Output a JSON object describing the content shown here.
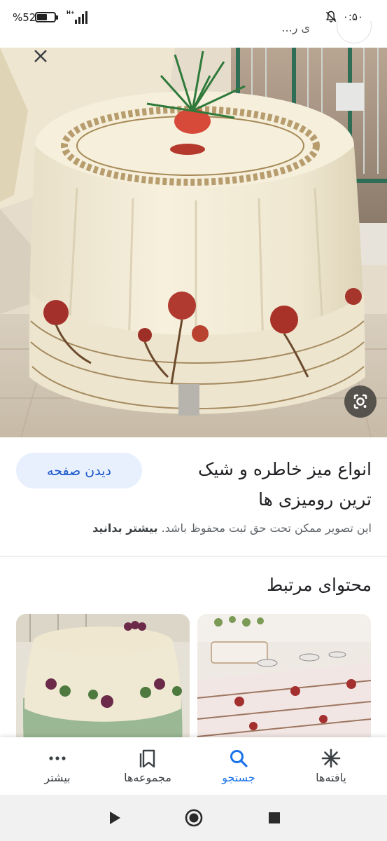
{
  "status_bar": {
    "battery_percent": "52",
    "battery_level": 0.52,
    "network": "H+",
    "time": "۰:۵۰"
  },
  "underlay": {
    "title_fragment": "...ی ر"
  },
  "viewer": {
    "close_icon": "close-icon",
    "lens_icon": "google-lens-icon"
  },
  "result": {
    "visit_label": "دیدن صفحه",
    "title": "انواع میز خاطره و شیک ترین رومیزی ها",
    "copyright_text": "این تصویر ممکن تحت حق ثبت محفوظ باشد.",
    "learn_more": "بیشتر بدانید"
  },
  "related": {
    "title": "محتوای مرتبط"
  },
  "bottom_nav": {
    "items": [
      {
        "label": "یافته‌ها",
        "icon": "discover-asterisk-icon"
      },
      {
        "label": "جستجو",
        "icon": "search-icon"
      },
      {
        "label": "مجموعه‌ها",
        "icon": "collections-bookmark-icon"
      },
      {
        "label": "بیشتر",
        "icon": "more-dots-icon"
      }
    ],
    "active": "جستجو"
  },
  "system_nav": {
    "back_icon": "back-triangle-icon",
    "home_icon": "home-circle-icon",
    "recents_icon": "recents-square-icon"
  },
  "colors": {
    "accent_blue": "#1a73e8",
    "visit_button_bg": "#e8f0fe",
    "visit_button_text": "#1a56c8"
  }
}
